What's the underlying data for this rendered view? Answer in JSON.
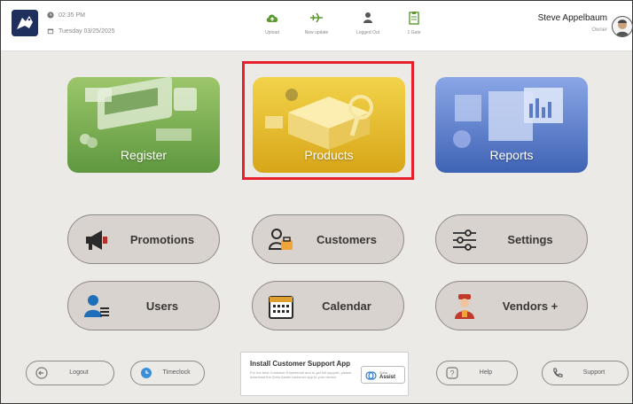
{
  "header": {
    "time": "02:35 PM",
    "date": "Tuesday 03/25/2025",
    "status_items": [
      {
        "label": "Upload",
        "icon": "cloud-upload-icon",
        "color": "#5b9a2e"
      },
      {
        "label": "New update",
        "icon": "airplane-icon",
        "color": "#5b9a2e"
      },
      {
        "label": "Logged Out",
        "icon": "user-icon",
        "color": "#555555"
      },
      {
        "label": "1 Gate",
        "icon": "clipboard-icon",
        "color": "#5b9a2e"
      }
    ],
    "user_name": "Steve Appelbaum",
    "user_role": "Owner"
  },
  "tiles": [
    {
      "label": "Register",
      "color": "#6ea44a"
    },
    {
      "label": "Products",
      "color": "#e6bb2c"
    },
    {
      "label": "Reports",
      "color": "#5476c4"
    }
  ],
  "highlight_color": "#e5202a",
  "menu": [
    {
      "label": "Promotions",
      "icon": "megaphone-icon"
    },
    {
      "label": "Customers",
      "icon": "customers-icon"
    },
    {
      "label": "Settings",
      "icon": "sliders-icon"
    },
    {
      "label": "Users",
      "icon": "user-list-icon"
    },
    {
      "label": "Calendar",
      "icon": "calendar-icon"
    },
    {
      "label": "Vendors +",
      "icon": "vendor-icon"
    }
  ],
  "footer": {
    "logout": "Logout",
    "timeclock": "Timeclock",
    "promo_title": "Install Customer Support App",
    "promo_body": "For the best Customer Experience and to get full support, please download the Zoho Assist customer app to your device.",
    "promo_badge_small": "Zoho",
    "promo_badge_big": "Assist",
    "help": "Help",
    "support": "Support"
  }
}
